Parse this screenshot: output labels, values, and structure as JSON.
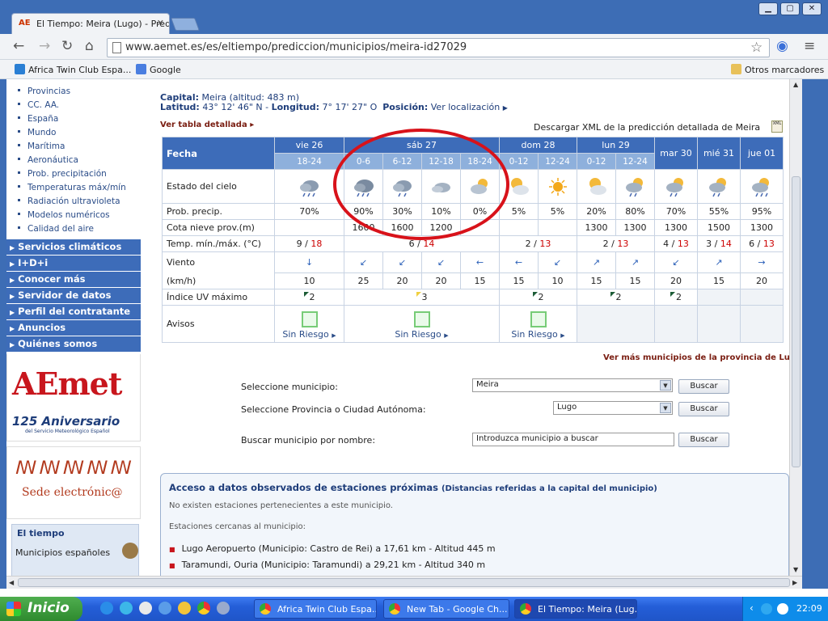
{
  "browser": {
    "tab_title": "El Tiempo: Meira (Lugo) - Pred",
    "url": "www.aemet.es/es/eltiempo/prediccion/municipios/meira-id27029",
    "bookmarks": [
      "Africa Twin Club Espa...",
      "Google"
    ],
    "other_bookmarks": "Otros marcadores"
  },
  "sidebar": {
    "links": [
      "Provincias",
      "CC. AA.",
      "España",
      "Mundo",
      "Marítima",
      "Aeronáutica",
      "Prob. precipitación",
      "Temperaturas máx/mín",
      "Radiación ultravioleta",
      "Modelos numéricos",
      "Calidad del aire"
    ],
    "sections": [
      "Servicios climáticos",
      "I+D+i",
      "Conocer más",
      "Servidor de datos",
      "Perfil del contratante",
      "Anuncios",
      "Quiénes somos"
    ],
    "aemet_logo": "AEmet",
    "aemet_anniv": "125 Aniversario",
    "aemet_sub": "del Servicio Meteorológico Español",
    "sede": "Sede electrónic@",
    "eltiempo_title": "El tiempo",
    "eltiempo_item": "Municipios españoles"
  },
  "header": {
    "capital_label": "Capital:",
    "capital_value": "Meira (altitud: 483 m)",
    "lat_label": "Latitud:",
    "lat_value": "43° 12' 46\" N",
    "lon_label": "Longitud:",
    "lon_value": "7° 17' 27\" O",
    "pos_label": "Posición:",
    "pos_link": "Ver localización",
    "tabla_link": "Ver tabla detallada",
    "xml_link": "Descargar XML de la predicción detallada de Meira"
  },
  "forecast": {
    "fecha_label": "Fecha",
    "days": [
      "vie 26",
      "sáb 27",
      "dom 28",
      "lun 29",
      "mar 30",
      "mié 31",
      "jue 01"
    ],
    "periods": [
      "18-24",
      "0-6",
      "6-12",
      "12-18",
      "18-24",
      "0-12",
      "12-24",
      "0-12",
      "12-24"
    ],
    "row_labels": {
      "sky": "Estado del cielo",
      "precip": "Prob. precip.",
      "snow": "Cota nieve prov.(m)",
      "temp": "Temp. mín./máx. (°C)",
      "wind": "Viento",
      "wind_unit": "(km/h)",
      "uv": "Índice UV máximo",
      "avisos": "Avisos"
    },
    "precip": [
      "70%",
      "90%",
      "30%",
      "10%",
      "0%",
      "5%",
      "5%",
      "20%",
      "80%",
      "70%",
      "55%",
      "95%"
    ],
    "snow": [
      "",
      "1600",
      "1600",
      "1200",
      "",
      "",
      "",
      "1300",
      "1300",
      "1300",
      "1500",
      "1300"
    ],
    "temp": [
      {
        "min": "9",
        "max": "18"
      },
      {
        "min": "6",
        "max": "14"
      },
      {
        "min": "2",
        "max": "13"
      },
      {
        "min": "2",
        "max": "13"
      },
      {
        "min": "4",
        "max": "13"
      },
      {
        "min": "3",
        "max": "14"
      },
      {
        "min": "6",
        "max": "13"
      }
    ],
    "wind_dir": [
      "↓",
      "↙",
      "↙",
      "↙",
      "←",
      "←",
      "↙",
      "↗",
      "↗",
      "↙",
      "↗",
      "→"
    ],
    "wind_speed": [
      "10",
      "25",
      "20",
      "20",
      "15",
      "15",
      "10",
      "15",
      "15",
      "20",
      "15",
      "20"
    ],
    "uv": [
      "2",
      "3",
      "2",
      "2",
      "2"
    ],
    "avisos": [
      "Sin Riesgo",
      "Sin Riesgo",
      "Sin Riesgo"
    ]
  },
  "links": {
    "more_municipios": "Ver más municipios de la provincia de Lugo"
  },
  "search": {
    "mun_label": "Seleccione municipio:",
    "mun_value": "Meira",
    "prov_label": "Seleccione Provincia o Ciudad Autónoma:",
    "prov_value": "Lugo",
    "name_label": "Buscar municipio por nombre:",
    "name_value": "Introduzca municipio a buscar",
    "button": "Buscar"
  },
  "acceso": {
    "title": "Acceso a datos observados de estaciones próximas",
    "subtitle": "(Distancias referidas a la capital del municipio)",
    "none": "No existen estaciones pertenecientes a este municipio.",
    "near": "Estaciones cercanas al municipio:",
    "stations": [
      "Lugo Aeropuerto (Municipio:  Castro de Rei) a 17,61 km - Altitud 445 m",
      "Taramundi, Ouria (Municipio:  Taramundi) a 29,21 km - Altitud 340 m"
    ]
  },
  "taskbar": {
    "start": "Inicio",
    "tasks": [
      "Africa Twin Club Espa...",
      "New Tab - Google Ch...",
      "El Tiempo: Meira (Lug..."
    ],
    "clock": "22:09"
  }
}
